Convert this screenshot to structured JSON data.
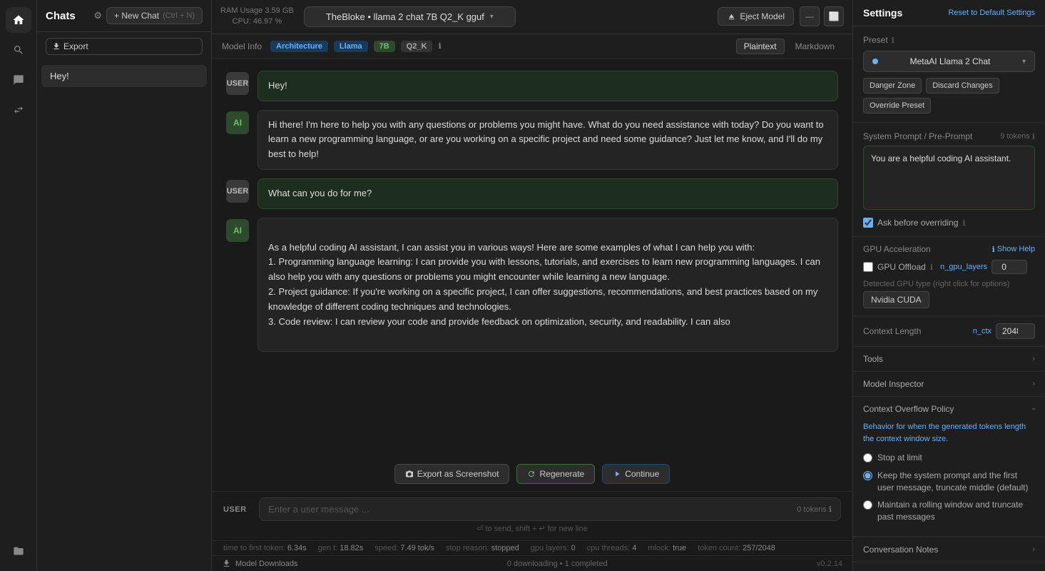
{
  "app": {
    "version": "v0.2.14"
  },
  "topbar": {
    "ram_label": "RAM Usage",
    "ram_value": "3.59 GB",
    "cpu_label": "CPU:",
    "cpu_value": "46.97 %",
    "model_name": "TheBloke • llama 2 chat 7B Q2_K gguf",
    "eject_label": "Eject Model"
  },
  "model_info": {
    "label": "Model Info",
    "arch_label": "Architecture",
    "arch_value": "Llama",
    "size_value": "7B",
    "quant_value": "Q2_K",
    "info_icon": "ℹ",
    "format_plaintext": "Plaintext",
    "format_markdown": "Markdown"
  },
  "chats": {
    "title": "Chats",
    "new_chat_label": "+ New Chat",
    "new_chat_shortcut": "(Ctrl + N)",
    "export_label": "Export",
    "items": [
      {
        "name": "Hey!",
        "active": true
      }
    ]
  },
  "messages": [
    {
      "role": "USER",
      "content": "Hey!"
    },
    {
      "role": "AI",
      "content": "Hi there! I'm here to help you with any questions or problems you might have. What do you need assistance with today? Do you want to learn a new programming language, or are you working on a specific project and need some guidance? Just let me know, and I'll do my best to help!"
    },
    {
      "role": "USER",
      "content": "What can you do for me?"
    },
    {
      "role": "AI",
      "content": "As a helpful coding AI assistant, I can assist you in various ways! Here are some examples of what I can help you with:\n1. Programming language learning: I can provide you with lessons, tutorials, and exercises to learn new programming languages. I can also help you with any questions or problems you might encounter while learning a new language.\n2. Project guidance: If you're working on a specific project, I can offer suggestions, recommendations, and best practices based on my knowledge of different coding techniques and technologies.\n3. Code review: I can review your code and provide feedback on optimization, security, and readability. I can also"
    }
  ],
  "action_buttons": {
    "export_screenshot": "Export as Screenshot",
    "regenerate": "Regenerate",
    "continue": "Continue"
  },
  "input": {
    "placeholder": "Enter a user message ...",
    "token_count": "0 tokens",
    "hint": "⏎ to send, shift + ↵ for new line",
    "user_label": "USER"
  },
  "status_bar": {
    "time_to_first": "time to first token:",
    "time_val": "6.34s",
    "gen_t": "gen t:",
    "gen_t_val": "18.82s",
    "speed": "speed:",
    "speed_val": "7.49 tok/s",
    "stop_reason": "stop reason:",
    "stop_val": "stopped",
    "gpu_layers": "gpu layers:",
    "gpu_val": "0",
    "cpu_threads": "cpu threads:",
    "cpu_threads_val": "4",
    "mlock": "mlock:",
    "mlock_val": "true",
    "token_count": "token count:",
    "token_count_val": "257/2048"
  },
  "bottom_bar": {
    "model_downloads_label": "Model Downloads",
    "download_status": "0 downloading • 1 completed"
  },
  "settings": {
    "title": "Settings",
    "reset_label": "Reset to Default Settings",
    "preset_section_label": "Preset",
    "preset_name": "MetaAI Llama 2 Chat",
    "danger_zone_label": "Danger Zone",
    "discard_changes_label": "Discard Changes",
    "override_preset_label": "Override Preset",
    "system_prompt_label": "System Prompt / Pre-Prompt",
    "token_count": "9 tokens",
    "system_prompt_value": "You are a helpful coding AI assistant.",
    "ask_before_label": "Ask before overriding",
    "gpu_accel_label": "GPU Acceleration",
    "show_help_label": "Show Help",
    "gpu_offload_label": "GPU Offload",
    "gpu_offload_value": "0",
    "n_gpu_layers_label": "n_gpu_layers",
    "detected_gpu_label": "Detected GPU type (right click for options)",
    "gpu_badge_value": "Nvidia CUDA",
    "context_length_label": "Context Length",
    "n_ctx_label": "n_ctx",
    "context_length_value": "2048",
    "tools_label": "Tools",
    "model_inspector_label": "Model Inspector",
    "context_overflow_label": "Context Overflow Policy",
    "overflow_desc": "Behavior for when the generated tokens length the context window size.",
    "stop_at_limit_label": "Stop at limit",
    "keep_system_prompt_label": "Keep the system prompt and the first user message, truncate middle (default)",
    "rolling_window_label": "Maintain a rolling window and truncate past messages",
    "conversation_notes_label": "Conversation Notes"
  }
}
